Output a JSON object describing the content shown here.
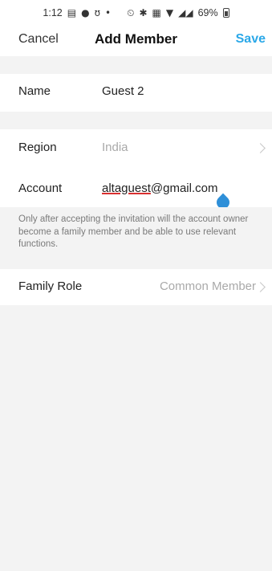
{
  "status_bar": {
    "time": "1:12",
    "battery": "69%"
  },
  "header": {
    "cancel_label": "Cancel",
    "title": "Add Member",
    "save_label": "Save",
    "accent_color": "#2ba8e8"
  },
  "form": {
    "name": {
      "label": "Name",
      "value": "Guest 2"
    },
    "region": {
      "label": "Region",
      "value": "India"
    },
    "account": {
      "label": "Account",
      "value_underlined": "altaguest",
      "value_rest": "@gmail.com"
    },
    "note": "Only after accepting the invitation will the account owner become a family member and be able to use relevant functions.",
    "family_role": {
      "label": "Family Role",
      "value": "Common Member"
    }
  }
}
